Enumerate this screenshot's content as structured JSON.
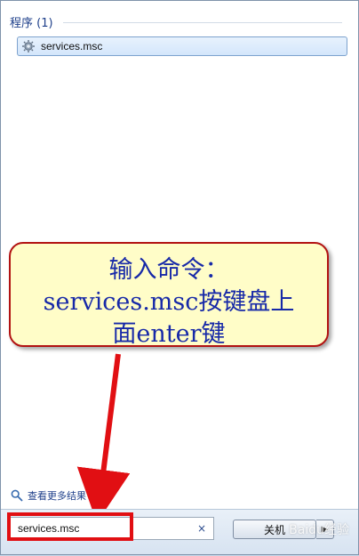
{
  "programs": {
    "section_title": "程序 (1)",
    "items": [
      {
        "label": "services.msc",
        "icon": "gear-icon"
      }
    ]
  },
  "annotation": {
    "text": "输入命令：\nservices.msc按键盘上\n面enter键"
  },
  "footer": {
    "more_results": "查看更多结果",
    "search_value": "services.msc",
    "clear_icon": "×",
    "shutdown_label": "关机",
    "shutdown_arrow": "▶",
    "watermark": "Baidu经验"
  },
  "colors": {
    "highlight": "#e10f13",
    "callout_bg": "#fffdc8",
    "callout_border": "#b21212",
    "callout_text": "#1729a8"
  }
}
